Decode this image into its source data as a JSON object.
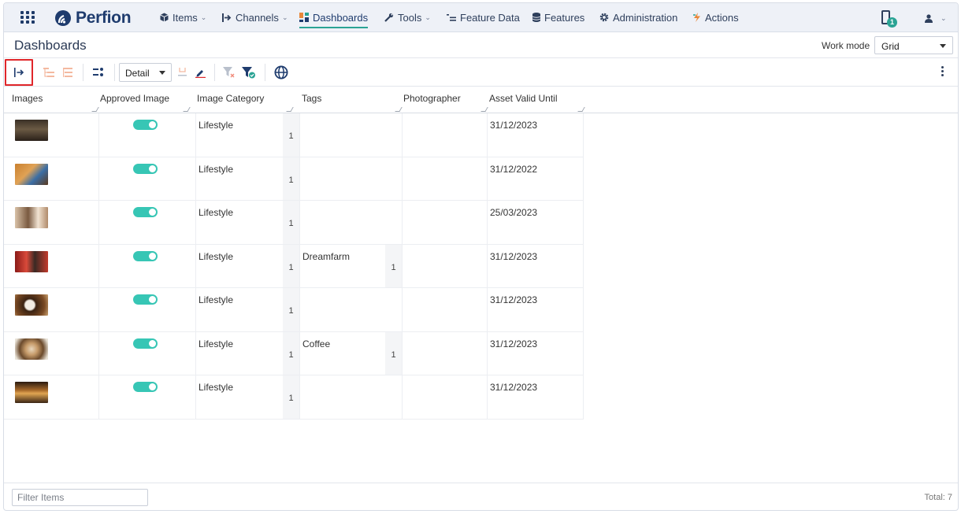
{
  "nav": {
    "logo": "Perfion",
    "items": [
      {
        "label": "Items",
        "icon": "cube-icon",
        "has_caret": true
      },
      {
        "label": "Channels",
        "icon": "channels-icon",
        "has_caret": true
      },
      {
        "label": "Dashboards",
        "icon": "dashboard-icon",
        "has_caret": false,
        "active": true
      },
      {
        "label": "Tools",
        "icon": "wrench-icon",
        "has_caret": true
      },
      {
        "label": "Feature Data",
        "icon": "list-icon",
        "has_caret": false
      },
      {
        "label": "Features",
        "icon": "database-icon",
        "has_caret": false
      },
      {
        "label": "Administration",
        "icon": "gear-icon",
        "has_caret": false
      },
      {
        "label": "Actions",
        "icon": "lightning-icon",
        "has_caret": false
      }
    ],
    "notification_count": "1",
    "colors": {
      "accent": "#2aa394",
      "navy": "#1f3c6e"
    }
  },
  "header": {
    "title": "Dashboards",
    "work_mode_label": "Work mode",
    "work_mode_value": "Grid"
  },
  "toolbar": {
    "view_select_value": "Detail",
    "highlighted_button": "expand-panel-button"
  },
  "grid": {
    "columns": [
      "Images",
      "Approved Image",
      "Image Category",
      "Tags",
      "Photographer",
      "Asset Valid Until"
    ],
    "rows": [
      {
        "image": "cafe-interior",
        "approved": true,
        "category": "Lifestyle",
        "category_count": "1",
        "tag": "",
        "tag_count": "",
        "photographer": "",
        "valid_until": "31/12/2023"
      },
      {
        "image": "coffee-table",
        "approved": true,
        "category": "Lifestyle",
        "category_count": "1",
        "tag": "",
        "tag_count": "",
        "photographer": "",
        "valid_until": "31/12/2022"
      },
      {
        "image": "barista",
        "approved": true,
        "category": "Lifestyle",
        "category_count": "1",
        "tag": "",
        "tag_count": "",
        "photographer": "",
        "valid_until": "25/03/2023"
      },
      {
        "image": "espresso-machine",
        "approved": true,
        "category": "Lifestyle",
        "category_count": "1",
        "tag": "Dreamfarm",
        "tag_count": "1",
        "photographer": "",
        "valid_until": "31/12/2023"
      },
      {
        "image": "coffee-cup",
        "approved": true,
        "category": "Lifestyle",
        "category_count": "1",
        "tag": "",
        "tag_count": "",
        "photographer": "",
        "valid_until": "31/12/2023"
      },
      {
        "image": "latte-art",
        "approved": true,
        "category": "Lifestyle",
        "category_count": "1",
        "tag": "Coffee",
        "tag_count": "1",
        "photographer": "",
        "valid_until": "31/12/2023"
      },
      {
        "image": "coffee-shop-warm",
        "approved": true,
        "category": "Lifestyle",
        "category_count": "1",
        "tag": "",
        "tag_count": "",
        "photographer": "",
        "valid_until": "31/12/2023"
      }
    ]
  },
  "footer": {
    "filter_placeholder": "Filter Items",
    "total_label": "Total: 7"
  }
}
